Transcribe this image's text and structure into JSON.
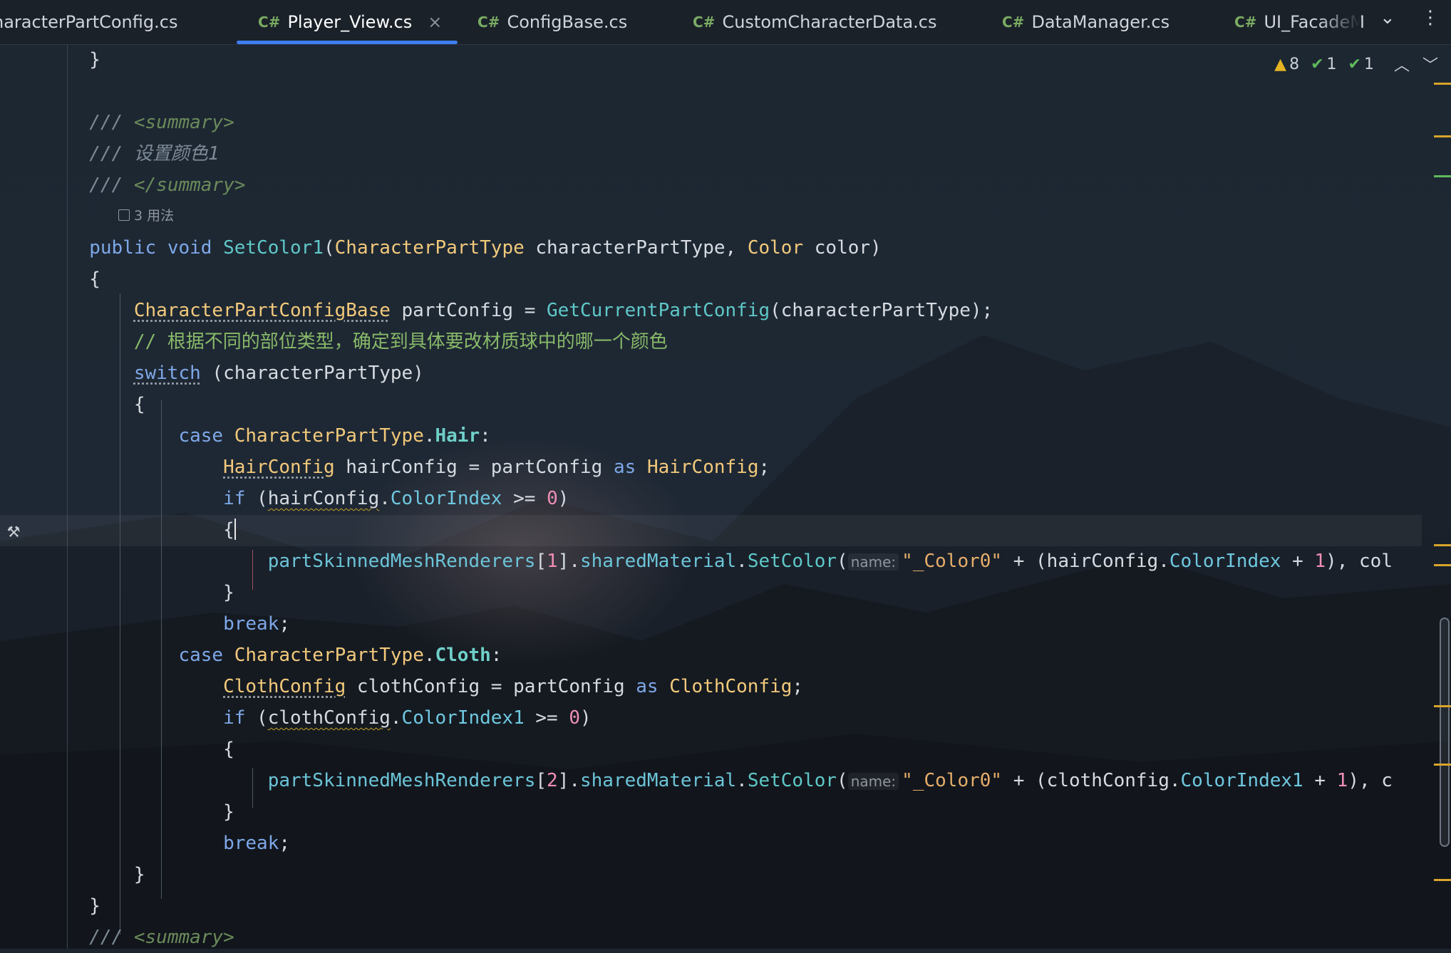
{
  "tabs": [
    {
      "label": "haracterPartConfig.cs",
      "has_cs": false,
      "active": false
    },
    {
      "label": "Player_View.cs",
      "has_cs": true,
      "active": true
    },
    {
      "label": "ConfigBase.cs",
      "has_cs": true,
      "active": false
    },
    {
      "label": "CustomCharacterData.cs",
      "has_cs": true,
      "active": false
    },
    {
      "label": "DataManager.cs",
      "has_cs": true,
      "active": false
    },
    {
      "label": "UI_FacadeM",
      "has_cs": true,
      "active": false
    }
  ],
  "tab_cs_label": "C#",
  "tab_close": "×",
  "tab_controls": {
    "dropdown": "⌄",
    "more": "⋮"
  },
  "inspection": {
    "warnings": "8",
    "ok": "1",
    "ok_double": "1"
  },
  "usage_hint": "3 用法",
  "code": {
    "doc_open": "/// ",
    "summary_open": "<summary>",
    "summary_close": "</summary>",
    "doc_text": "/// 设置颜色1",
    "comment": "// 根据不同的部位类型，确定到具体要改材质球中的哪一个颜色",
    "hint_name": "name:"
  },
  "colors": {
    "accent": "#3d7ef0",
    "warning": "#e6b422",
    "ok": "#5fb95a"
  }
}
